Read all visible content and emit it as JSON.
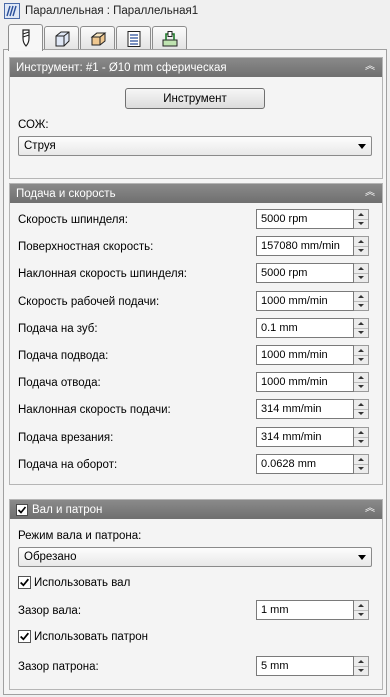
{
  "window": {
    "title": "Параллельная : Параллельная1",
    "icon": "parallel-toolpath-icon"
  },
  "tabs": [
    {
      "name": "tool",
      "icon": "tool-icon",
      "active": true
    },
    {
      "name": "stock",
      "icon": "stock-box-icon",
      "active": false
    },
    {
      "name": "geometry",
      "icon": "geometry-box-icon",
      "active": false
    },
    {
      "name": "passes",
      "icon": "passes-icon",
      "active": false
    },
    {
      "name": "linking",
      "icon": "linking-icon",
      "active": false
    }
  ],
  "tool_section": {
    "title": "Инструмент: #1 - Ø10 mm сферическая",
    "tool_button": "Инструмент",
    "coolant_label": "СОЖ:",
    "coolant_value": "Струя"
  },
  "feed_section": {
    "title": "Подача и скорость",
    "rows": [
      {
        "label": "Скорость шпинделя:",
        "value": "5000 rpm"
      },
      {
        "label": "Поверхностная скорость:",
        "value": "157080 mm/min"
      },
      {
        "label": "Наклонная скорость шпинделя:",
        "value": "5000 rpm"
      },
      {
        "label": "Скорость рабочей подачи:",
        "value": "1000 mm/min"
      },
      {
        "label": "Подача на зуб:",
        "value": "0.1 mm"
      },
      {
        "label": "Подача подвода:",
        "value": "1000 mm/min"
      },
      {
        "label": "Подача отвода:",
        "value": "1000 mm/min"
      },
      {
        "label": "Наклонная скорость подачи:",
        "value": "314 mm/min"
      },
      {
        "label": "Подача врезания:",
        "value": "314 mm/min"
      },
      {
        "label": "Подача на оборот:",
        "value": "0.0628 mm"
      }
    ]
  },
  "shaft_section": {
    "title": "Вал и патрон",
    "enabled": true,
    "mode_label": "Режим вала и патрона:",
    "mode_value": "Обрезано",
    "use_shaft_label": "Использовать вал",
    "shaft_clearance_label": "Зазор вала:",
    "shaft_clearance_value": "1 mm",
    "use_holder_label": "Использовать патрон",
    "holder_clearance_label": "Зазор патрона:",
    "holder_clearance_value": "5 mm"
  }
}
